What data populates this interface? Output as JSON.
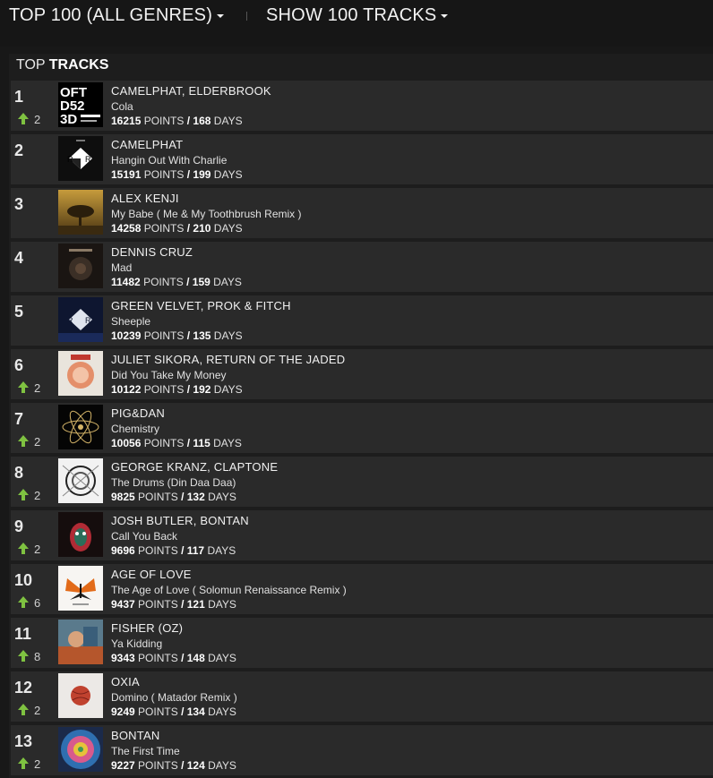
{
  "header": {
    "genre_label": "TOP 100 (ALL GENRES)",
    "count_label": "SHOW 100 TRACKS"
  },
  "section": {
    "prefix": "TOP",
    "bold": "TRACKS"
  },
  "units": {
    "points": "POINTS",
    "days": "DAYS",
    "sep": "/"
  },
  "colors": {
    "accent": "#7fc241",
    "row_bg": "#2a2a2a",
    "page_bg": "#181818"
  },
  "tracks": [
    {
      "rank": "1",
      "move": "2",
      "artist": "CAMELPHAT, ELDERBROOK",
      "title": "Cola",
      "points": "16215",
      "days": "168",
      "art": "cola-art"
    },
    {
      "rank": "2",
      "move": "",
      "artist": "CAMELPHAT",
      "title": "Hangin Out With Charlie",
      "points": "15191",
      "days": "199",
      "art": "rr-art"
    },
    {
      "rank": "3",
      "move": "",
      "artist": "ALEX KENJI",
      "title": "My Babe ( Me & My Toothbrush Remix )",
      "points": "14258",
      "days": "210",
      "art": "tree-art"
    },
    {
      "rank": "4",
      "move": "",
      "artist": "DENNIS CRUZ",
      "title": "Mad",
      "points": "11482",
      "days": "159",
      "art": "dark-art"
    },
    {
      "rank": "5",
      "move": "",
      "artist": "GREEN VELVET, PROK & FITCH",
      "title": "Sheeple",
      "points": "10239",
      "days": "135",
      "art": "rr-blue-art"
    },
    {
      "rank": "6",
      "move": "2",
      "artist": "JULIET SIKORA, RETURN OF THE JADED",
      "title": "Did You Take My Money",
      "points": "10122",
      "days": "192",
      "art": "face-art"
    },
    {
      "rank": "7",
      "move": "2",
      "artist": "PIG&DAN",
      "title": "Chemistry",
      "points": "10056",
      "days": "115",
      "art": "atom-art"
    },
    {
      "rank": "8",
      "move": "2",
      "artist": "GEORGE KRANZ, CLAPTONE",
      "title": "The Drums (Din Daa Daa)",
      "points": "9825",
      "days": "132",
      "art": "sketch-art"
    },
    {
      "rank": "9",
      "move": "2",
      "artist": "JOSH BUTLER, BONTAN",
      "title": "Call You Back",
      "points": "9696",
      "days": "117",
      "art": "mask-art"
    },
    {
      "rank": "10",
      "move": "6",
      "artist": "AGE OF LOVE",
      "title": "The Age of Love ( Solomun Renaissance Remix )",
      "points": "9437",
      "days": "121",
      "art": "butterfly-art"
    },
    {
      "rank": "11",
      "move": "8",
      "artist": "FISHER (OZ)",
      "title": "Ya Kidding",
      "points": "9343",
      "days": "148",
      "art": "painting-art"
    },
    {
      "rank": "12",
      "move": "2",
      "artist": "OXIA",
      "title": "Domino ( Matador Remix )",
      "points": "9249",
      "days": "134",
      "art": "ball-art"
    },
    {
      "rank": "13",
      "move": "2",
      "artist": "BONTAN",
      "title": "The First Time",
      "points": "9227",
      "days": "124",
      "art": "mosaic-art"
    }
  ]
}
